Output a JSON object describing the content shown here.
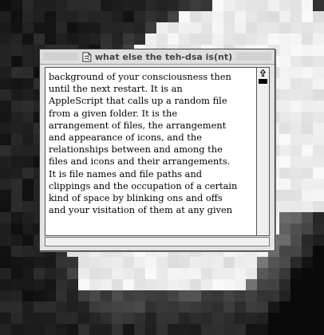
{
  "window": {
    "title": "what else the teh-dsa is(nt)",
    "title_icon": "document-icon"
  },
  "document": {
    "lines": [
      "background of your consciousness then",
      "until the next restart. It is an",
      "AppleScript that calls up a random file",
      "from a given folder. It is the",
      "arrangement of files, the arrangement",
      "and appearance of icons, and the",
      "relationships between and among the",
      "files and icons and their arrangements.",
      "It is file names and file paths and",
      "clippings and the occupation of a certain",
      "kind of space by blinking ons and offs",
      "and your visitation of them at any given"
    ]
  },
  "scrollbar": {
    "up_icon": "scroll-up-arrow-icon",
    "position_fraction": 0.0
  },
  "desktop_background": {
    "description_colors": [
      "#111111",
      "#333333",
      "#777777",
      "#bbbbbb",
      "#eeeeee",
      "#ffffff"
    ]
  }
}
